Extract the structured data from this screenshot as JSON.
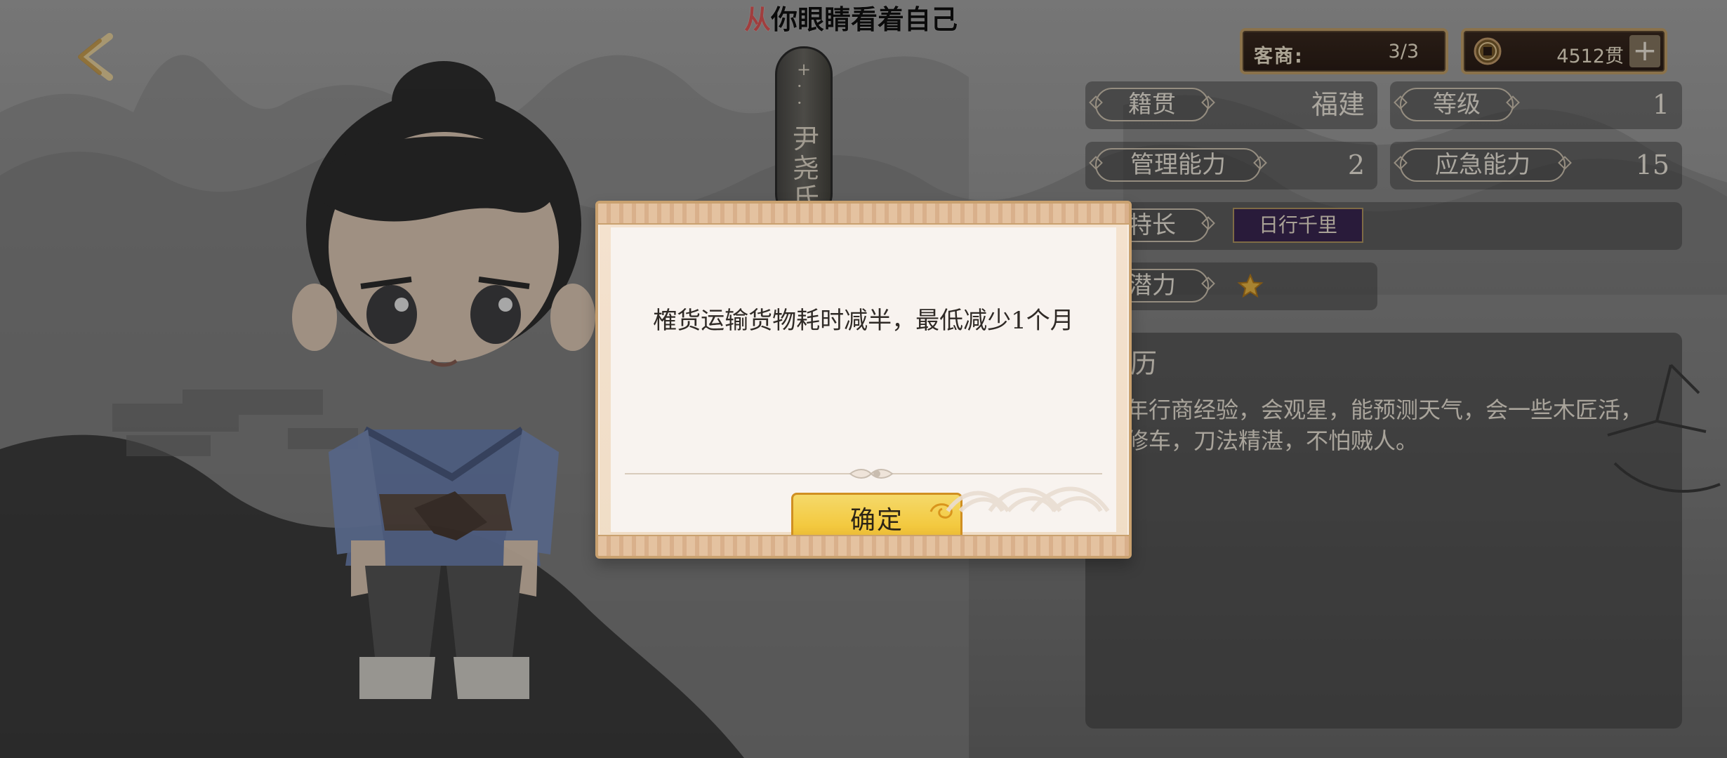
{
  "top_title": {
    "highlight": "从",
    "text": "你眼睛看着自己"
  },
  "hud": {
    "guest_label": "客商:",
    "guest_value": "3/3",
    "money_value": "4512贯",
    "plus_label": "+"
  },
  "character": {
    "name": "尹尧氏",
    "deco": "十\n·\n·",
    "stats": [
      {
        "label": "籍贯",
        "value": "福建"
      },
      {
        "label": "等级",
        "value": "1"
      },
      {
        "label": "管理能力",
        "value": "2"
      },
      {
        "label": "应急能力",
        "value": "15"
      }
    ],
    "specialty_label": "特长",
    "specialty_tag": "日行千里",
    "potential_label": "潜力",
    "bio_title": "履历",
    "bio_text": "十年行商经验，会观星，能预测天气，会一些木匠活，能修车，刀法精湛，不怕贼人。"
  },
  "dialog": {
    "message": "榷货运输货物耗时减半，最低减少1个月",
    "confirm": "确定"
  },
  "colors": {
    "title_highlight": "#e65a59",
    "dialog_bg": "#f8f3ef",
    "button_yellow": "#f3c93f",
    "skill_purple": "#3c2754"
  },
  "icons": [
    "back-arrow-icon",
    "coin-icon",
    "plus-icon",
    "star-icon",
    "divider-ornament-icon"
  ]
}
